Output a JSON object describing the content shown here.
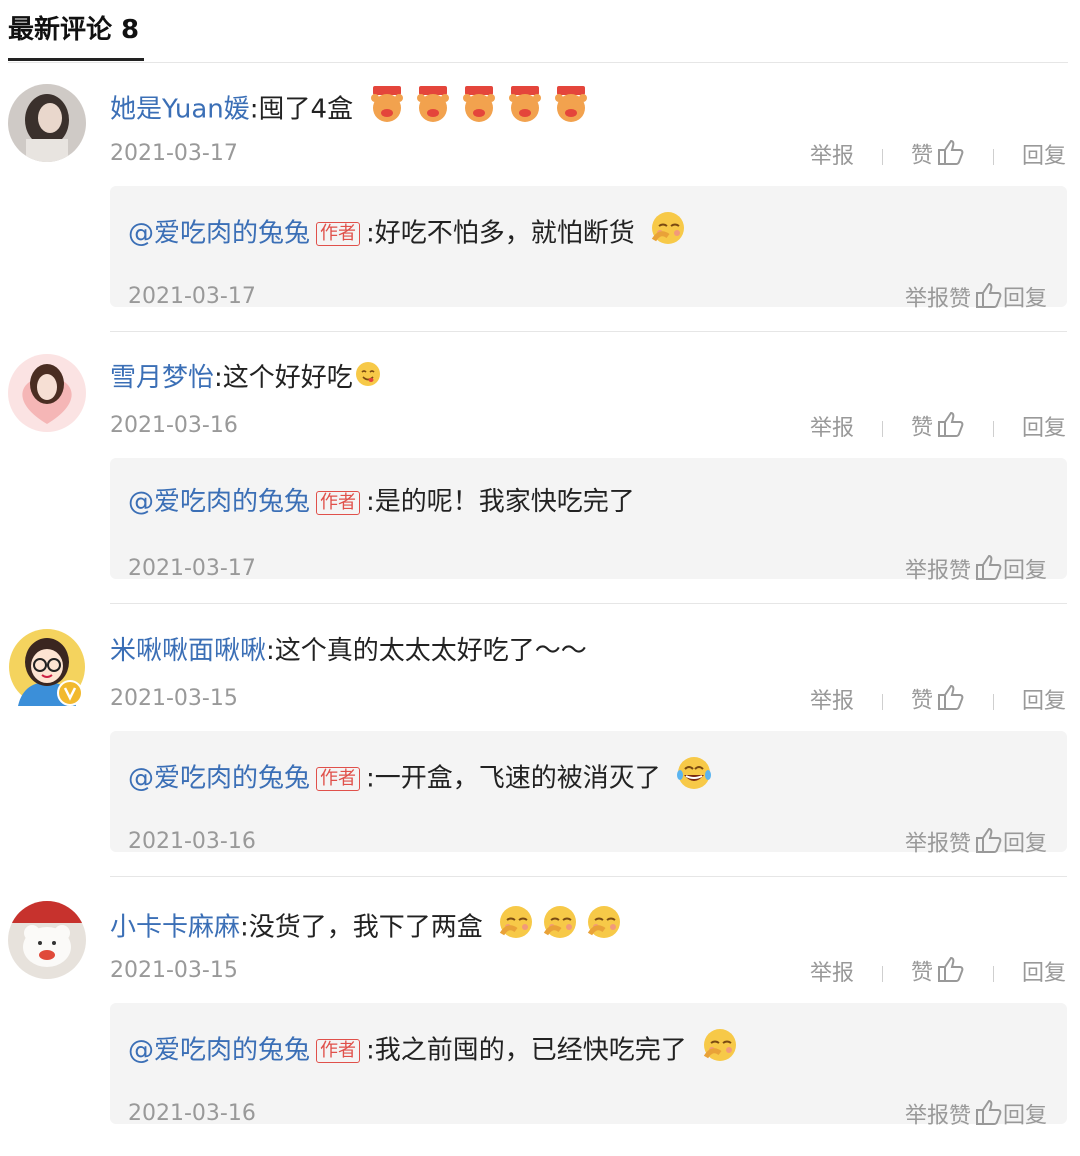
{
  "header": {
    "title": "最新评论 8"
  },
  "actions": {
    "report": "举报",
    "like": "赞",
    "reply": "回复"
  },
  "reply_tag": "作者",
  "comments": [
    {
      "user": "她是Yuan媛",
      "text": ":囤了4盒",
      "emojis": [
        "bear-emoji",
        "bear-emoji",
        "bear-emoji",
        "bear-emoji",
        "bear-emoji"
      ],
      "date": "2021-03-17",
      "reply": {
        "user": "@爱吃肉的兔兔",
        "text": ":好吃不怕多，就怕断货",
        "emoji": "shy-face-emoji",
        "date": "2021-03-17"
      }
    },
    {
      "user": "雪月梦怡",
      "text": ":这个好好吃",
      "emojis": [
        "yummy-face-emoji"
      ],
      "date": "2021-03-16",
      "reply": {
        "user": "@爱吃肉的兔兔",
        "text": ":是的呢！我家快吃完了",
        "emoji": "",
        "date": "2021-03-17"
      }
    },
    {
      "user": "米啾啾面啾啾",
      "text": ":这个真的太太太好吃了～～",
      "emojis": [],
      "date": "2021-03-15",
      "reply": {
        "user": "@爱吃肉的兔兔",
        "text": ":一开盒，飞速的被消灭了",
        "emoji": "laugh-cry-emoji",
        "date": "2021-03-16"
      }
    },
    {
      "user": "小卡卡麻麻",
      "text": ":没货了，我下了两盒",
      "emojis": [
        "shy-face-emoji",
        "shy-face-emoji",
        "shy-face-emoji"
      ],
      "date": "2021-03-15",
      "reply": {
        "user": "@爱吃肉的兔兔",
        "text": ":我之前囤的，已经快吃完了",
        "emoji": "shy-face-emoji",
        "date": "2021-03-16"
      }
    }
  ]
}
